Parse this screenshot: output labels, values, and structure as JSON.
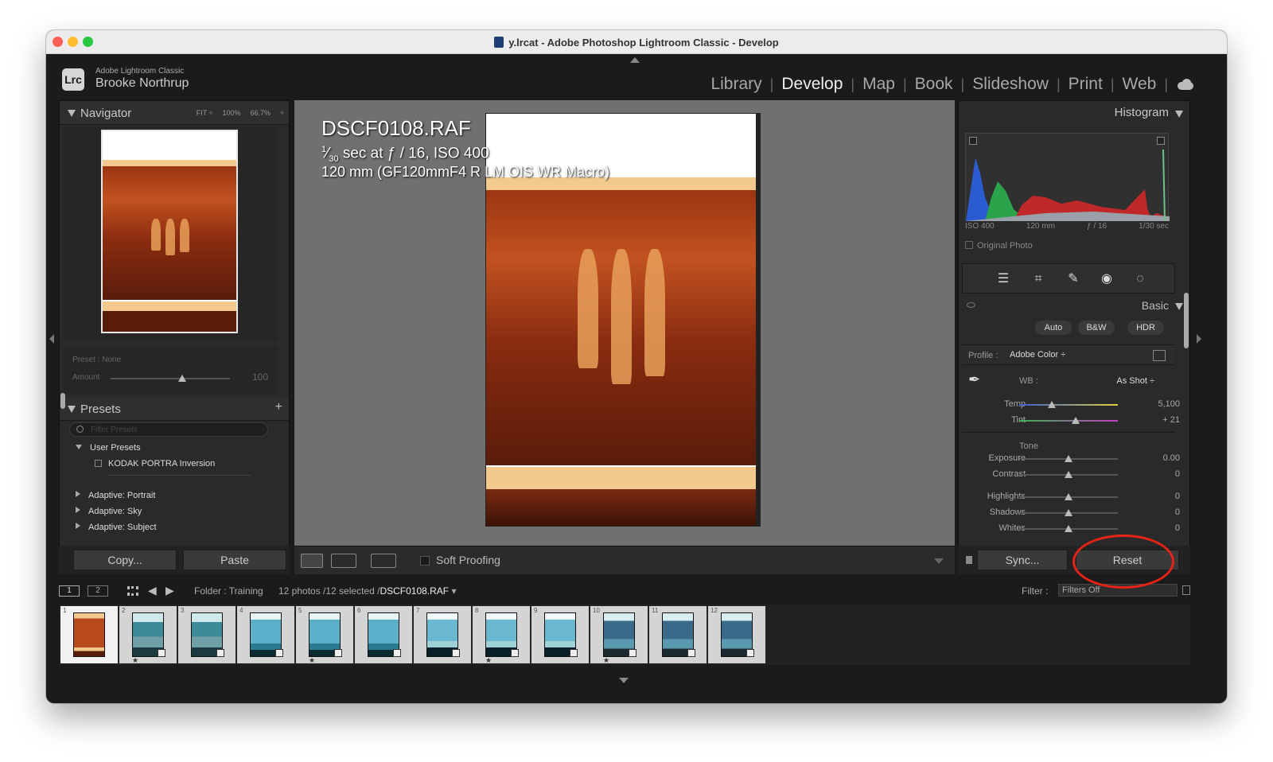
{
  "window": {
    "title": "y.lrcat - Adobe Photoshop Lightroom Classic - Develop"
  },
  "identity": {
    "app": "Adobe Lightroom Classic",
    "user": "Brooke Northrup",
    "logo": "Lrc"
  },
  "modules": [
    {
      "label": "Library"
    },
    {
      "label": "Develop",
      "active": true
    },
    {
      "label": "Map"
    },
    {
      "label": "Book"
    },
    {
      "label": "Slideshow"
    },
    {
      "label": "Print"
    },
    {
      "label": "Web"
    }
  ],
  "module_separator": "|",
  "navigator": {
    "label": "Navigator",
    "opts": [
      "FIT ÷",
      "100%",
      "66.7%",
      "÷"
    ]
  },
  "preset_amount": {
    "preset_label": "Preset : None",
    "amount_label": "Amount",
    "amount_value": "100",
    "amount_fraction": 0.6
  },
  "presets": {
    "label": "Presets",
    "add": "+",
    "search_placeholder": "Filter Presets",
    "user_group": "User Presets",
    "user_items": [
      "KODAK PORTRA Inversion"
    ],
    "groups": [
      "Adaptive: Portrait",
      "Adaptive: Sky",
      "Adaptive: Subject"
    ]
  },
  "left_buttons": {
    "copy": "Copy...",
    "paste": "Paste"
  },
  "photo_info": {
    "filename": "DSCF0108.RAF",
    "exposure_num": "1",
    "exposure_den": "30",
    "exposure_rest": " sec at ƒ / 16, ISO 400",
    "lens": "120 mm (GF120mmF4 R LM OIS WR Macro)"
  },
  "toolbar": {
    "soft_proofing": "Soft Proofing"
  },
  "histogram": {
    "label": "Histogram",
    "meta": [
      "ISO 400",
      "120 mm",
      "ƒ / 16",
      "1/30 sec"
    ],
    "original_photo": "Original Photo"
  },
  "basic": {
    "label": "Basic",
    "treatments": [
      "Auto",
      "B&W",
      "HDR"
    ],
    "profile_label": "Profile :",
    "profile_value": "Adobe Color ÷",
    "wb_label": "WB :",
    "wb_value": "As Shot ÷",
    "temp": {
      "label": "Temp",
      "value": "5,100",
      "fraction": 0.33
    },
    "tint": {
      "label": "Tint",
      "value": "+ 21",
      "fraction": 0.57
    },
    "tone_label": "Tone",
    "sliders": [
      {
        "label": "Exposure",
        "value": "0.00",
        "fraction": 0.5
      },
      {
        "label": "Contrast",
        "value": "0",
        "fraction": 0.5
      },
      {
        "label": "Highlights",
        "value": "0",
        "fraction": 0.5
      },
      {
        "label": "Shadows",
        "value": "0",
        "fraction": 0.5
      },
      {
        "label": "Whites",
        "value": "0",
        "fraction": 0.5
      }
    ]
  },
  "right_buttons": {
    "sync": "Sync...",
    "reset": "Reset"
  },
  "filmstrip_bar": {
    "view1": "1",
    "view2": "2",
    "folder": "Folder : Training",
    "count": "12 photos /12 selected /",
    "current_file": "DSCF0108.RAF",
    "filter_label": "Filter :",
    "filter_value": "Filters Off"
  },
  "filmstrip": [
    {
      "n": "1",
      "style": "neg"
    },
    {
      "n": "2",
      "style": "beach",
      "dot": true
    },
    {
      "n": "3",
      "style": "beach"
    },
    {
      "n": "4",
      "style": "sea"
    },
    {
      "n": "5",
      "style": "sea",
      "dot": true
    },
    {
      "n": "6",
      "style": "sea"
    },
    {
      "n": "7",
      "style": "tower"
    },
    {
      "n": "8",
      "style": "tower",
      "dot": true
    },
    {
      "n": "9",
      "style": "tower"
    },
    {
      "n": "10",
      "style": "group",
      "dot": true
    },
    {
      "n": "11",
      "style": "group"
    },
    {
      "n": "12",
      "style": "group"
    }
  ],
  "colors": {
    "accent_red": "#e62317",
    "panel": "#2a2a2a",
    "center_bg": "#707070"
  }
}
